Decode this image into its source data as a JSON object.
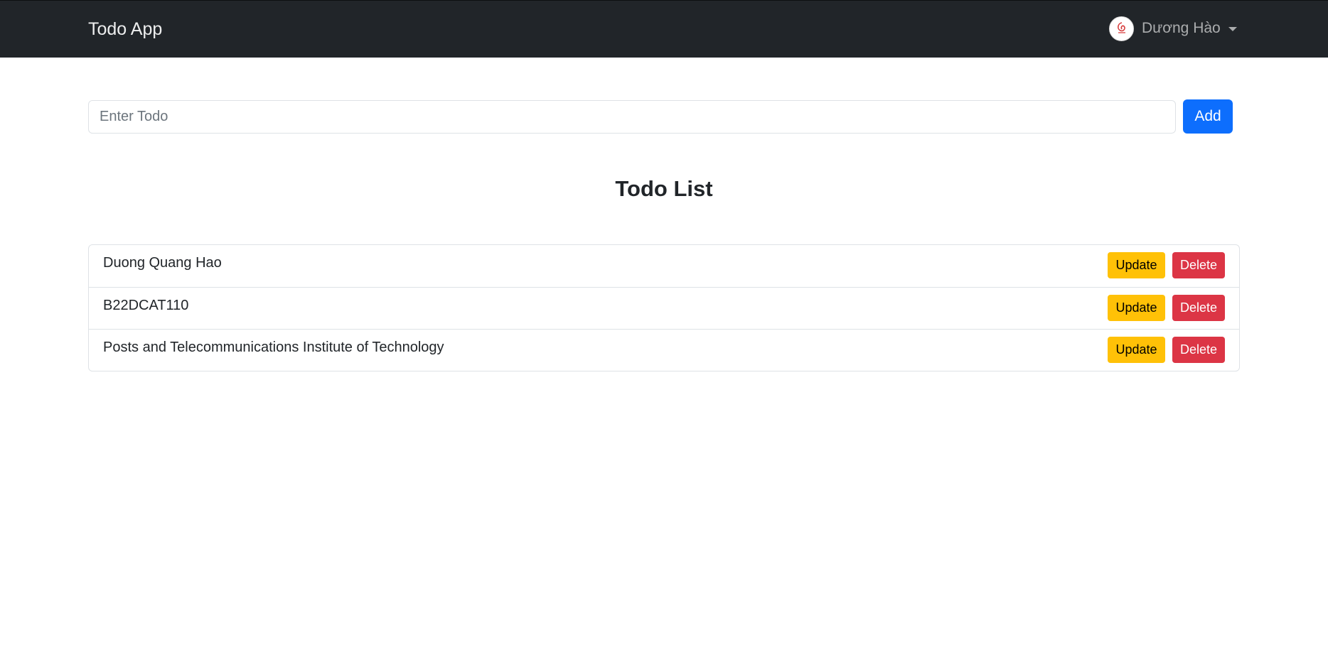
{
  "navbar": {
    "brand": "Todo App",
    "user": {
      "avatar_icon": "avatar-logo-icon",
      "name": "Dương Hào",
      "dropdown_icon": "caret-down-icon"
    }
  },
  "form": {
    "input_placeholder": "Enter Todo",
    "input_value": "",
    "add_label": "Add"
  },
  "list": {
    "title": "Todo List",
    "items": [
      {
        "text": "Duong Quang Hao",
        "update_label": "Update",
        "delete_label": "Delete"
      },
      {
        "text": "B22DCAT110",
        "update_label": "Update",
        "delete_label": "Delete"
      },
      {
        "text": "Posts and Telecommunications Institute of Technology",
        "update_label": "Update",
        "delete_label": "Delete"
      }
    ]
  },
  "colors": {
    "navbar_bg": "#212529",
    "primary": "#0d6efd",
    "warning": "#ffc107",
    "danger": "#dc3545",
    "border": "#dee2e6"
  }
}
